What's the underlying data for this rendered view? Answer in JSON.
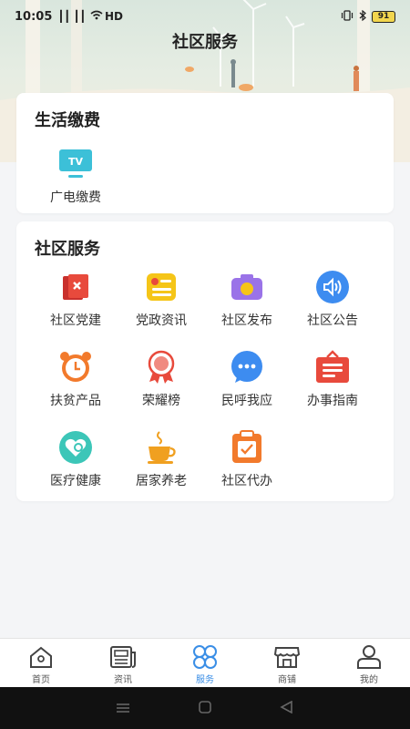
{
  "status_bar": {
    "time": "10:05",
    "network": "┃┃ ┃┃",
    "right_text": "HD",
    "battery": "91"
  },
  "page_title": "社区服务",
  "bills": {
    "title": "生活缴费",
    "items": [
      {
        "label": "广电缴费",
        "icon": "tv-icon",
        "tv_text": "TV"
      }
    ]
  },
  "services": {
    "title": "社区服务",
    "items": [
      {
        "label": "社区党建",
        "icon": "party-building-icon"
      },
      {
        "label": "党政资讯",
        "icon": "party-news-icon"
      },
      {
        "label": "社区发布",
        "icon": "camera-icon"
      },
      {
        "label": "社区公告",
        "icon": "speaker-icon"
      },
      {
        "label": "扶贫产品",
        "icon": "alarm-clock-icon"
      },
      {
        "label": "荣耀榜",
        "icon": "medal-icon"
      },
      {
        "label": "民呼我应",
        "icon": "chat-bubble-icon"
      },
      {
        "label": "办事指南",
        "icon": "signboard-icon"
      },
      {
        "label": "医疗健康",
        "icon": "health-heart-icon"
      },
      {
        "label": "居家养老",
        "icon": "tea-cup-icon"
      },
      {
        "label": "社区代办",
        "icon": "clipboard-icon"
      }
    ]
  },
  "tabbar": {
    "items": [
      {
        "label": "首页",
        "icon": "home-icon",
        "active": false
      },
      {
        "label": "资讯",
        "icon": "newspaper-icon",
        "active": false
      },
      {
        "label": "服务",
        "icon": "service-grid-icon",
        "active": true
      },
      {
        "label": "商铺",
        "icon": "store-icon",
        "active": false
      },
      {
        "label": "我的",
        "icon": "profile-icon",
        "active": false
      }
    ]
  },
  "colors": {
    "accent": "#3a8ee6",
    "red": "#e84a3c",
    "orange": "#f27a2c",
    "yellow": "#f5c518",
    "purple": "#9a73e8",
    "blue": "#3d8cf0",
    "teal": "#3cc6b8",
    "tv": "#3cc0d8"
  }
}
